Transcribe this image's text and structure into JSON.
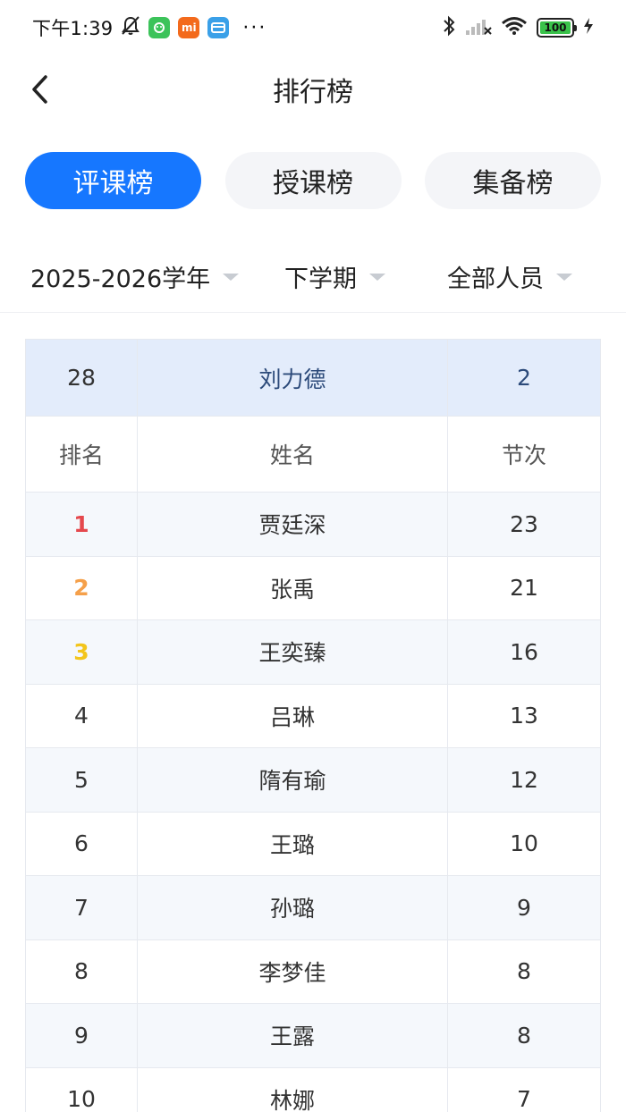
{
  "status_bar": {
    "time": "下午1:39",
    "dots": "···",
    "battery": "100",
    "app_mi_label": "mi"
  },
  "nav": {
    "title": "排行榜"
  },
  "tabs": [
    {
      "label": "评课榜",
      "active": true
    },
    {
      "label": "授课榜",
      "active": false
    },
    {
      "label": "集备榜",
      "active": false
    }
  ],
  "filters": {
    "year": "2025-2026学年",
    "term": "下学期",
    "scope": "全部人员"
  },
  "my_row": {
    "rank": "28",
    "name": "刘力德",
    "count": "2"
  },
  "table_header": {
    "rank": "排名",
    "name": "姓名",
    "count": "节次"
  },
  "rows": [
    {
      "rank": "1",
      "name": "贾廷深",
      "count": "23"
    },
    {
      "rank": "2",
      "name": "张禹",
      "count": "21"
    },
    {
      "rank": "3",
      "name": "王奕臻",
      "count": "16"
    },
    {
      "rank": "4",
      "name": "吕琳",
      "count": "13"
    },
    {
      "rank": "5",
      "name": "隋有瑜",
      "count": "12"
    },
    {
      "rank": "6",
      "name": "王璐",
      "count": "10"
    },
    {
      "rank": "7",
      "name": "孙璐",
      "count": "9"
    },
    {
      "rank": "8",
      "name": "李梦佳",
      "count": "8"
    },
    {
      "rank": "9",
      "name": "王露",
      "count": "8"
    },
    {
      "rank": "10",
      "name": "林娜",
      "count": "7"
    }
  ],
  "colors": {
    "accent": "#1677ff",
    "rank_1": "#e5484d",
    "rank_2": "#f5a04a",
    "rank_3": "#f3c51b",
    "my_row_bg": "#e3ecfb"
  }
}
